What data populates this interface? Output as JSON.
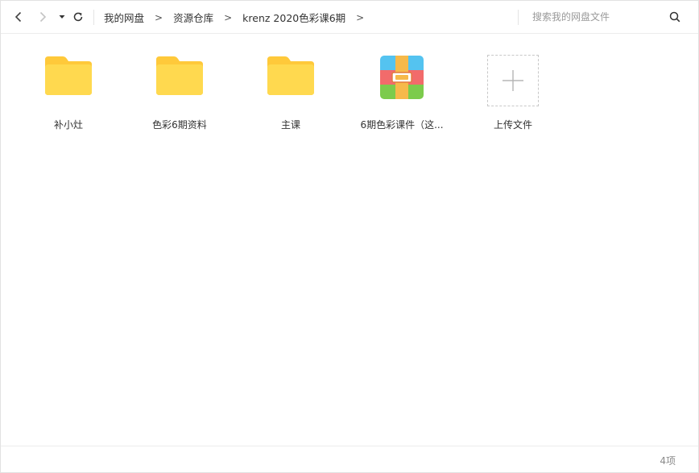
{
  "colors": {
    "folder_back": "#FFC93A",
    "folder_front": "#FFD94F",
    "archive_top": "#54C3F0",
    "archive_middle": "#F26B6B",
    "archive_bottom": "#7CCB4C",
    "archive_strap": "#F6B94A"
  },
  "toolbar": {
    "back_icon": "chevron-left-icon",
    "forward_icon": "chevron-right-icon",
    "dropdown_icon": "caret-down-icon",
    "refresh_icon": "refresh-icon",
    "search_icon": "search-icon"
  },
  "breadcrumb": {
    "items": [
      {
        "label": "我的网盘"
      },
      {
        "label": "资源仓库"
      },
      {
        "label": "krenz 2020色彩课6期"
      }
    ],
    "separator": ">"
  },
  "search": {
    "value": "",
    "placeholder": "搜索我的网盘文件"
  },
  "files": [
    {
      "label": "补小灶",
      "type": "folder-icon"
    },
    {
      "label": "色彩6期资料",
      "type": "folder-icon"
    },
    {
      "label": "主课",
      "type": "folder-icon"
    },
    {
      "label": "6期色彩课件（这...",
      "type": "archive-icon"
    },
    {
      "label": "上传文件",
      "type": "plus-icon"
    }
  ],
  "status": {
    "count": "4项"
  }
}
